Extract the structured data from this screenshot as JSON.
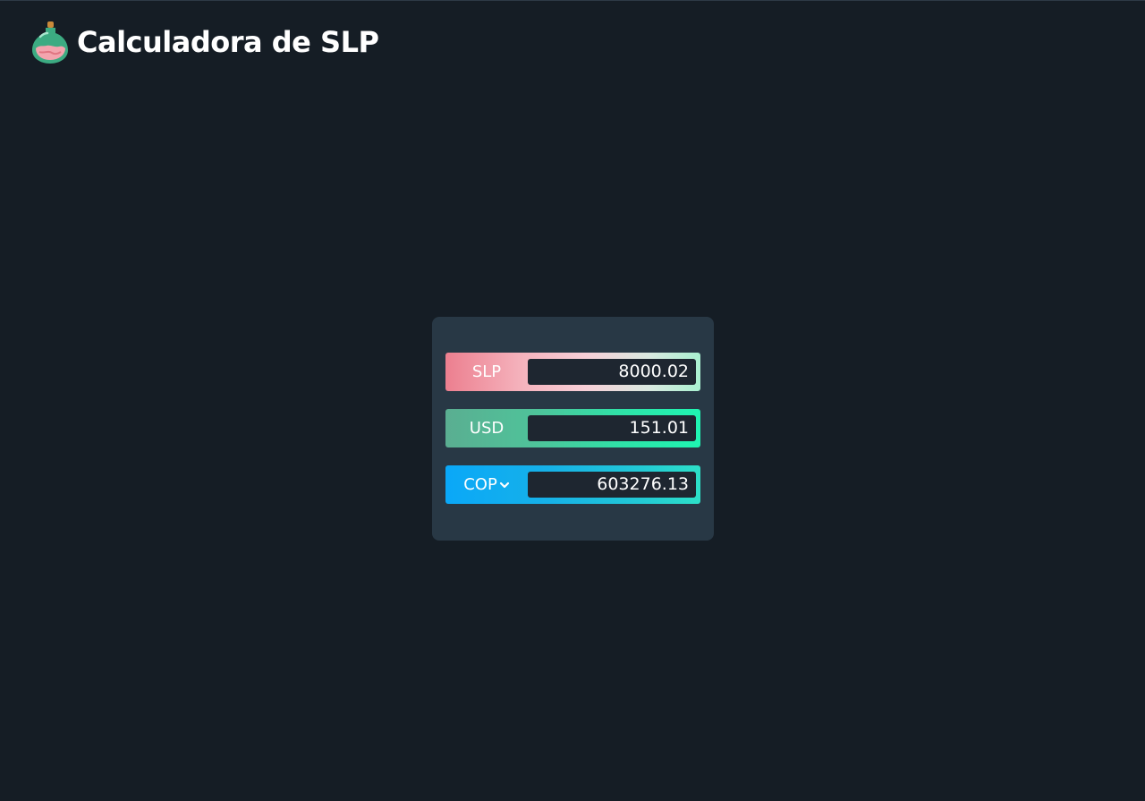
{
  "app": {
    "title": "Calculadora de SLP",
    "logo_icon": "potion-bottle-icon"
  },
  "converter": {
    "rows": [
      {
        "label": "SLP",
        "value": "8000.02"
      },
      {
        "label": "USD",
        "value": "151.01"
      },
      {
        "label": "COP",
        "value": "603276.13",
        "is_select": true,
        "icon": "chevron-down-icon"
      }
    ]
  },
  "colors": {
    "background": "#151d25",
    "card": "#283845",
    "input": "#1e2630",
    "slp_accent": "#ec7f8f",
    "usd_accent": "#2ee3a8",
    "cop_accent": "#0aa8f8"
  }
}
